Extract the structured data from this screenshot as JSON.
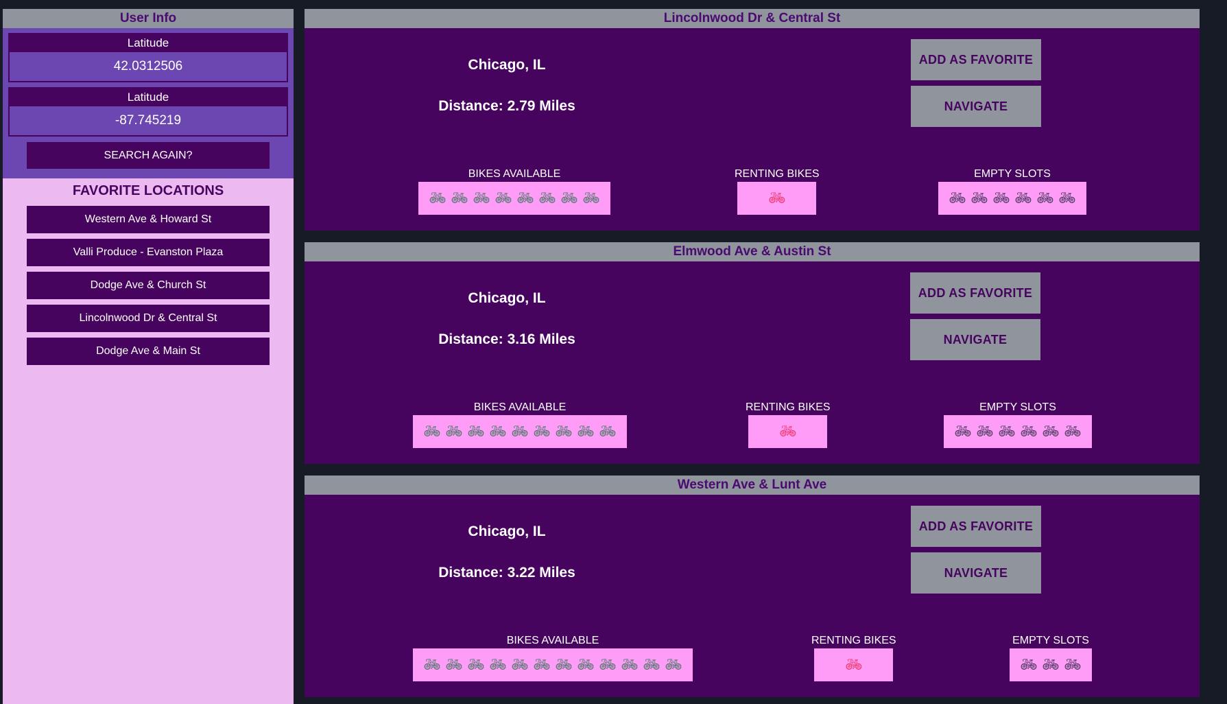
{
  "sidebar": {
    "title": "User Info",
    "latitude": {
      "label": "Latitude",
      "value": "42.0312506"
    },
    "longitude": {
      "label": "Latitude",
      "value": "-87.745219"
    },
    "search_again": "SEARCH AGAIN?",
    "favorites_title": "FAVORITE LOCATIONS",
    "favorites": [
      "Western Ave & Howard St",
      "Valli Produce - Evanston Plaza",
      "Dodge Ave & Church St",
      "Lincolnwood Dr & Central St",
      "Dodge Ave & Main St"
    ]
  },
  "stations": [
    {
      "name": "Lincolnwood Dr & Central St",
      "city": "Chicago, IL",
      "distance": "Distance: 2.79 Miles",
      "add_favorite": "ADD AS FAVORITE",
      "navigate": "NAVIGATE",
      "bikes_available_label": "BIKES AVAILABLE",
      "renting_label": "RENTING BIKES",
      "empty_label": "EMPTY SLOTS",
      "bikes_available": 8,
      "renting": 1,
      "empty_slots": 6
    },
    {
      "name": "Elmwood Ave & Austin St",
      "city": "Chicago, IL",
      "distance": "Distance: 3.16 Miles",
      "add_favorite": "ADD AS FAVORITE",
      "navigate": "NAVIGATE",
      "bikes_available_label": "BIKES AVAILABLE",
      "renting_label": "RENTING BIKES",
      "empty_label": "EMPTY SLOTS",
      "bikes_available": 9,
      "renting": 1,
      "empty_slots": 6
    },
    {
      "name": "Western Ave & Lunt Ave",
      "city": "Chicago, IL",
      "distance": "Distance: 3.22 Miles",
      "add_favorite": "ADD AS FAVORITE",
      "navigate": "NAVIGATE",
      "bikes_available_label": "BIKES AVAILABLE",
      "renting_label": "RENTING BIKES",
      "empty_label": "EMPTY SLOTS",
      "bikes_available": 12,
      "renting": 1,
      "empty_slots": 3
    }
  ],
  "icons": {
    "bike": "bicycle-icon"
  },
  "colors": {
    "background": "#161b26",
    "header": "#8f949d",
    "card": "#47045f",
    "sidebar": "#ecbaf1",
    "user_info": "#6c47b1",
    "stat_box": "#fe9cf8"
  }
}
